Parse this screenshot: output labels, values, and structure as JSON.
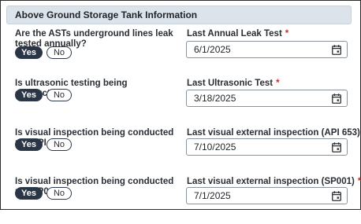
{
  "section": {
    "title": "Above Ground Storage Tank Information"
  },
  "rows": [
    {
      "question": "Are the ASTs underground lines leak tested annually?",
      "yes_label": "Yes",
      "no_label": "No",
      "field_label": "Last Annual Leak Test",
      "required_mark": "*",
      "date_value": "6/1/2025"
    },
    {
      "question": "Is ultrasonic testing being conducted?",
      "yes_label": "Yes",
      "no_label": "No",
      "field_label": "Last Ultrasonic Test",
      "required_mark": "*",
      "date_value": "3/18/2025"
    },
    {
      "question": "Is visual inspection being conducted per API 653?",
      "yes_label": "Yes",
      "no_label": "No",
      "field_label": "Last visual external inspection (API 653)",
      "required_mark": "*",
      "date_value": "7/10/2025"
    },
    {
      "question": "Is visual inspection being conducted per SP001?",
      "yes_label": "Yes",
      "no_label": "No",
      "field_label": "Last visual external inspection (SP001)",
      "required_mark": "*",
      "date_value": "7/1/2025"
    }
  ],
  "selected_option": "Yes",
  "icons": {
    "date_picker": "calendar-icon"
  },
  "colors": {
    "accent": "#2a3646",
    "required": "#d12b2b",
    "header_bg": "#dde3ea"
  }
}
